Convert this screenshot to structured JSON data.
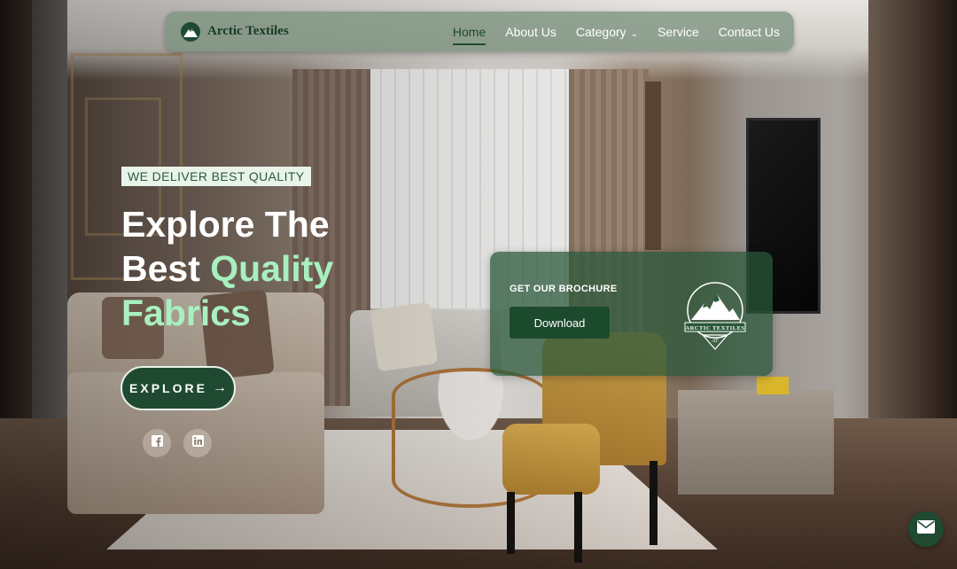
{
  "brand": {
    "name": "Arctic Textiles",
    "logo_icon": "mountain-logo-icon",
    "color": "#1f4a31"
  },
  "nav": {
    "items": [
      {
        "label": "Home",
        "active": true
      },
      {
        "label": "About Us",
        "active": false
      },
      {
        "label": "Category",
        "active": false,
        "has_dropdown": true
      },
      {
        "label": "Service",
        "active": false
      },
      {
        "label": "Contact Us",
        "active": false
      }
    ]
  },
  "hero": {
    "tagline": "WE DELIVER BEST QUALITY",
    "headline_part1": "Explore The Best ",
    "headline_highlight": "Quality Fabrics",
    "explore_label": "EXPLORE",
    "explore_icon": "arrow-right-icon",
    "highlight_color": "#a8f0bf",
    "social": [
      {
        "name": "facebook",
        "icon": "facebook-icon"
      },
      {
        "name": "linkedin",
        "icon": "linkedin-icon"
      }
    ]
  },
  "brochure": {
    "title": "GET OUR BROCHURE",
    "button_label": "Download",
    "logo_text": "ARCTIC TEXTILES",
    "logo_monogram": "AT",
    "logo_icon": "mountain-logo-icon"
  },
  "floating": {
    "mail_icon": "envelope-icon"
  }
}
